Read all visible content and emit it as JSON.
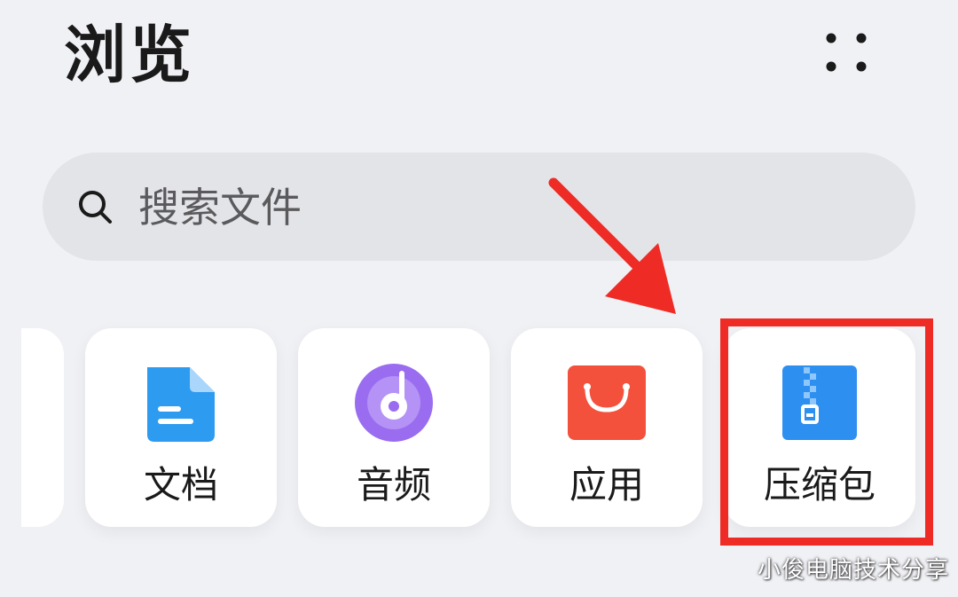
{
  "header": {
    "title": "浏览",
    "more_icon": "more-dots-icon"
  },
  "search": {
    "icon": "search-icon",
    "placeholder": "搜索文件"
  },
  "categories": [
    {
      "label": "文档",
      "icon": "document-icon",
      "color": "#2d9bf0"
    },
    {
      "label": "音频",
      "icon": "audio-disc-icon",
      "color": "#9a6cf0"
    },
    {
      "label": "应用",
      "icon": "shopping-bag-icon",
      "color": "#f4513d"
    },
    {
      "label": "压缩包",
      "icon": "zip-archive-icon",
      "color": "#2d8ff0"
    }
  ],
  "annotation": {
    "highlight_color": "#ef2b25",
    "highlighted_item": "压缩包"
  },
  "watermark": {
    "text": "小俊电脑技术分享"
  }
}
